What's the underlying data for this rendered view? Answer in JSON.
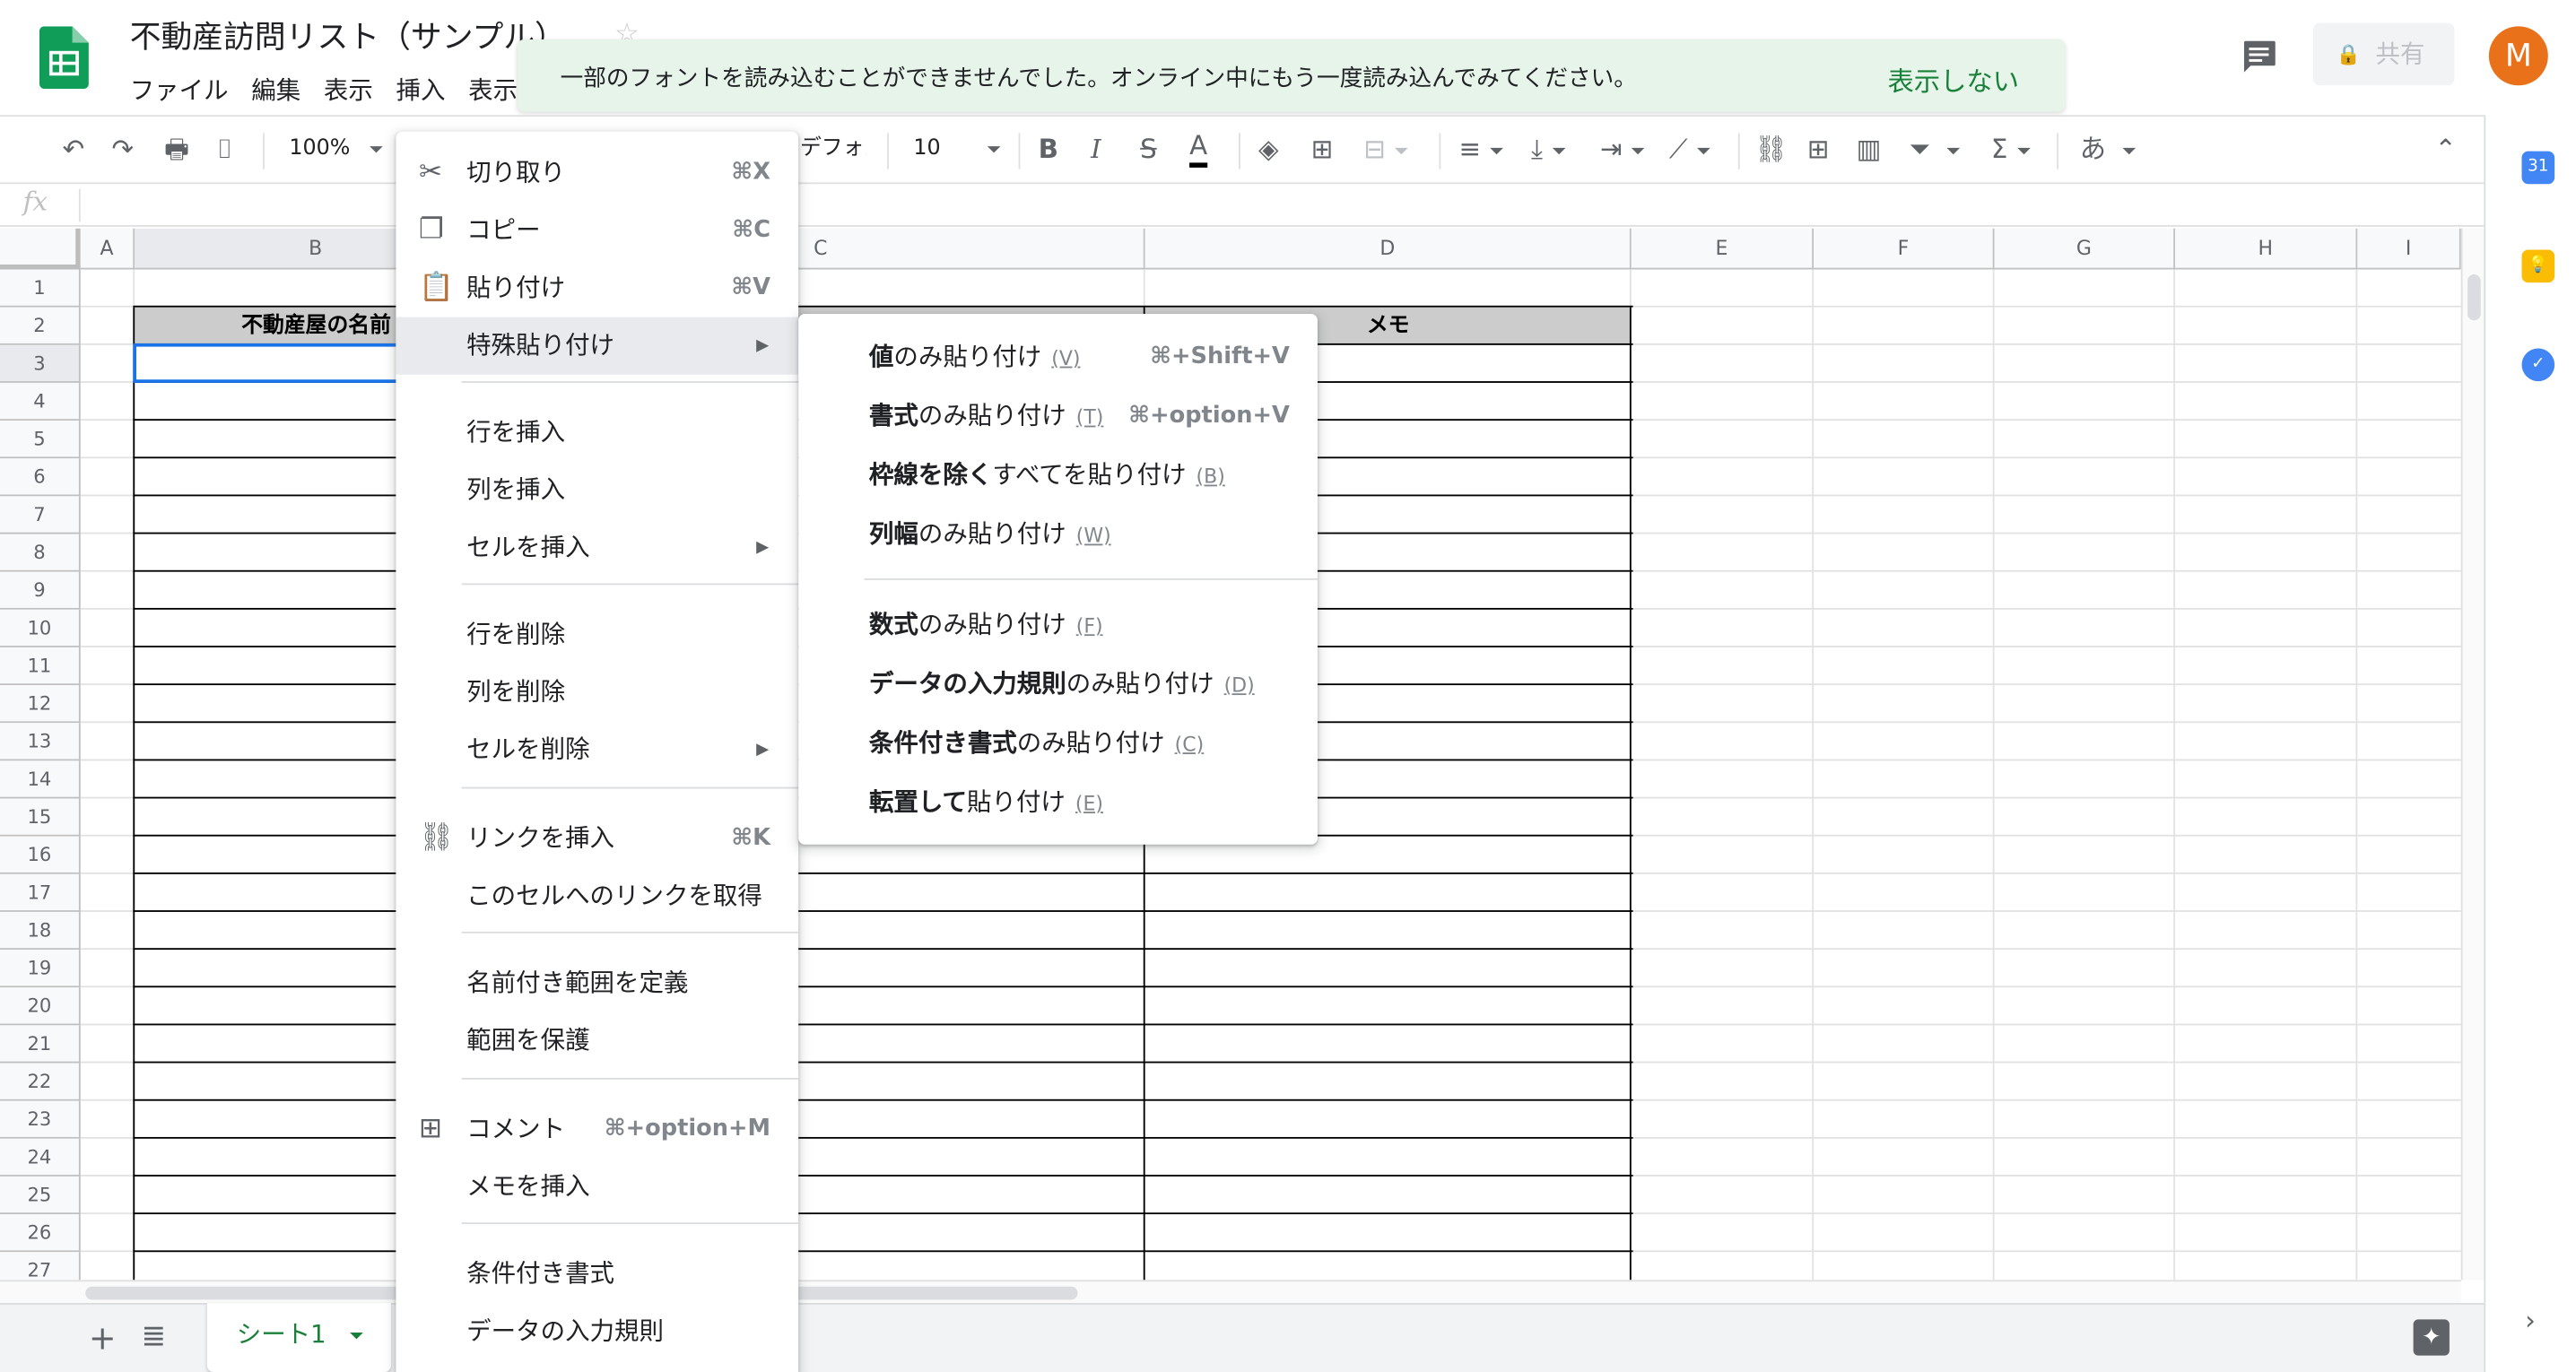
{
  "header": {
    "title": "不動産訪問リスト（サンプル）",
    "menu": [
      "ファイル",
      "編集",
      "表示",
      "挿入",
      "表示形式"
    ],
    "share_label": "共有",
    "avatar_initial": "M"
  },
  "notice": {
    "message": "一部のフォントを読み込むことができませんでした。オンライン中にもう一度読み込んでみてください。",
    "dismiss_label": "表示しない"
  },
  "toolbar": {
    "zoom": "100%",
    "font": "デフォルト...",
    "font_size": "10",
    "bold": "B",
    "italic": "I",
    "strike": "S",
    "text_color": "A",
    "ime": "あ"
  },
  "formula_bar": {
    "fx": "fx",
    "value": ""
  },
  "sheet": {
    "columns": [
      "A",
      "B",
      "C",
      "D",
      "E",
      "F",
      "G",
      "H",
      "I"
    ],
    "rows": [
      "1",
      "2",
      "3",
      "4",
      "5",
      "6",
      "7",
      "8",
      "9",
      "10",
      "11",
      "12",
      "13",
      "14",
      "15",
      "16",
      "17",
      "18",
      "19",
      "20",
      "21",
      "22",
      "23",
      "24",
      "25",
      "26",
      "27"
    ],
    "header_cells": {
      "B2": "不動産屋の名前",
      "D2": "メモ"
    },
    "active_tab": "シート1"
  },
  "context_menu": {
    "items": [
      {
        "label": "切り取り",
        "shortcut": "⌘X",
        "icon": "scissors-icon"
      },
      {
        "label": "コピー",
        "shortcut": "⌘C",
        "icon": "copy-icon"
      },
      {
        "label": "貼り付け",
        "shortcut": "⌘V",
        "icon": "paste-icon"
      },
      {
        "label": "特殊貼り付け",
        "submenu": true
      },
      {
        "label": "行を挿入"
      },
      {
        "label": "列を挿入"
      },
      {
        "label": "セルを挿入",
        "submenu": true
      },
      {
        "label": "行を削除"
      },
      {
        "label": "列を削除"
      },
      {
        "label": "セルを削除",
        "submenu": true
      },
      {
        "label": "リンクを挿入",
        "shortcut": "⌘K",
        "icon": "link-icon"
      },
      {
        "label": "このセルへのリンクを取得"
      },
      {
        "label": "名前付き範囲を定義"
      },
      {
        "label": "範囲を保護"
      },
      {
        "label": "コメント",
        "shortcut": "⌘+option+M",
        "icon": "comment-add-icon"
      },
      {
        "label": "メモを挿入"
      },
      {
        "label": "条件付き書式"
      },
      {
        "label": "データの入力規則"
      }
    ]
  },
  "paste_special_menu": {
    "items": [
      {
        "bold": "値",
        "rest": "のみ貼り付け",
        "key": "(V)",
        "shortcut": "⌘+Shift+V"
      },
      {
        "bold": "書式",
        "rest": "のみ貼り付け",
        "key": "(T)",
        "shortcut": "⌘+option+V"
      },
      {
        "bold": "枠線を除く",
        "rest": "すべてを貼り付け",
        "key": "(B)",
        "shortcut": ""
      },
      {
        "bold": "列幅",
        "rest": "のみ貼り付け",
        "key": "(W)",
        "shortcut": ""
      },
      {
        "bold": "数式",
        "rest": "のみ貼り付け",
        "key": "(F)",
        "shortcut": ""
      },
      {
        "bold": "データの入力規則",
        "rest": "のみ貼り付け",
        "key": "(D)",
        "shortcut": ""
      },
      {
        "bold": "条件付き書式",
        "rest": "のみ貼り付け",
        "key": "(C)",
        "shortcut": ""
      },
      {
        "bold": "転置して",
        "rest": "貼り付け",
        "key": "(E)",
        "shortcut": ""
      }
    ]
  },
  "colors": {
    "accent_green": "#188038",
    "notice_bg": "#e6f4ea",
    "selection_blue": "#1a73e8",
    "avatar_bg": "#e8711a",
    "header_cell_bg": "#cccccc"
  }
}
